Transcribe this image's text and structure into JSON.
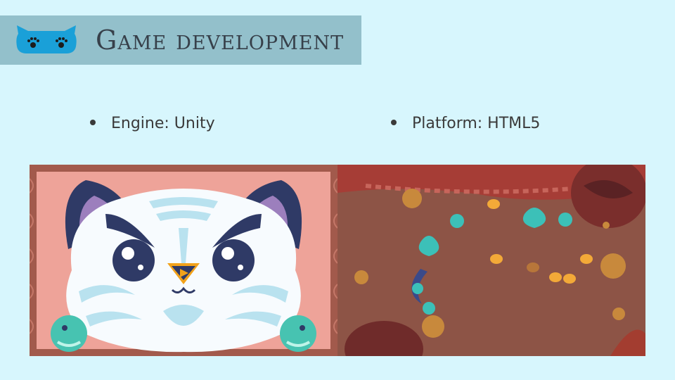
{
  "slide": {
    "title": "Game development",
    "background": "#d7f6fd",
    "title_bar_color": "#93c0cb",
    "logo_icon": "cat-ears-paw-logo-icon"
  },
  "bullets": [
    {
      "label": "Engine: Unity"
    },
    {
      "label": "Platform: HTML5"
    }
  ],
  "screenshots": {
    "left": {
      "subject": "tiger-face-game-art"
    },
    "right": {
      "subject": "cave-level-game-scene"
    }
  }
}
